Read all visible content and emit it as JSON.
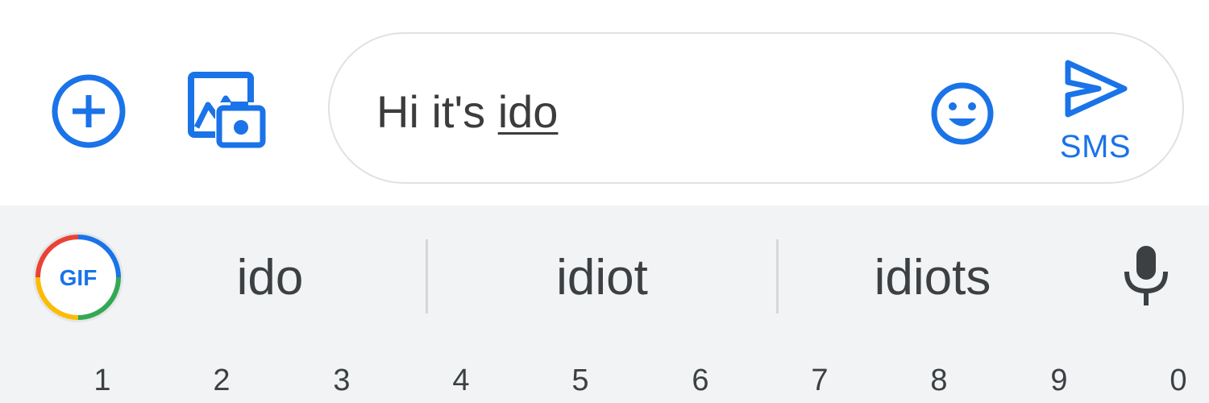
{
  "compose": {
    "add_icon": "add-circle-icon",
    "gallery_icon": "gallery-camera-icon",
    "message_prefix": "Hi it's ",
    "message_composing": "ido",
    "emoji_icon": "smiley-icon",
    "send_icon": "send-icon",
    "send_label": "SMS"
  },
  "keyboard": {
    "gif_label": "GIF",
    "suggestions": [
      "ido",
      "idiot",
      "idiots"
    ],
    "mic_icon": "microphone-icon",
    "number_keys": [
      "1",
      "2",
      "3",
      "4",
      "5",
      "6",
      "7",
      "8",
      "9",
      "0"
    ]
  },
  "colors": {
    "accent": "#1a73e8",
    "field_border": "#dfe1e5",
    "keyboard_bg": "#f1f3f4",
    "text": "#3c4043"
  }
}
